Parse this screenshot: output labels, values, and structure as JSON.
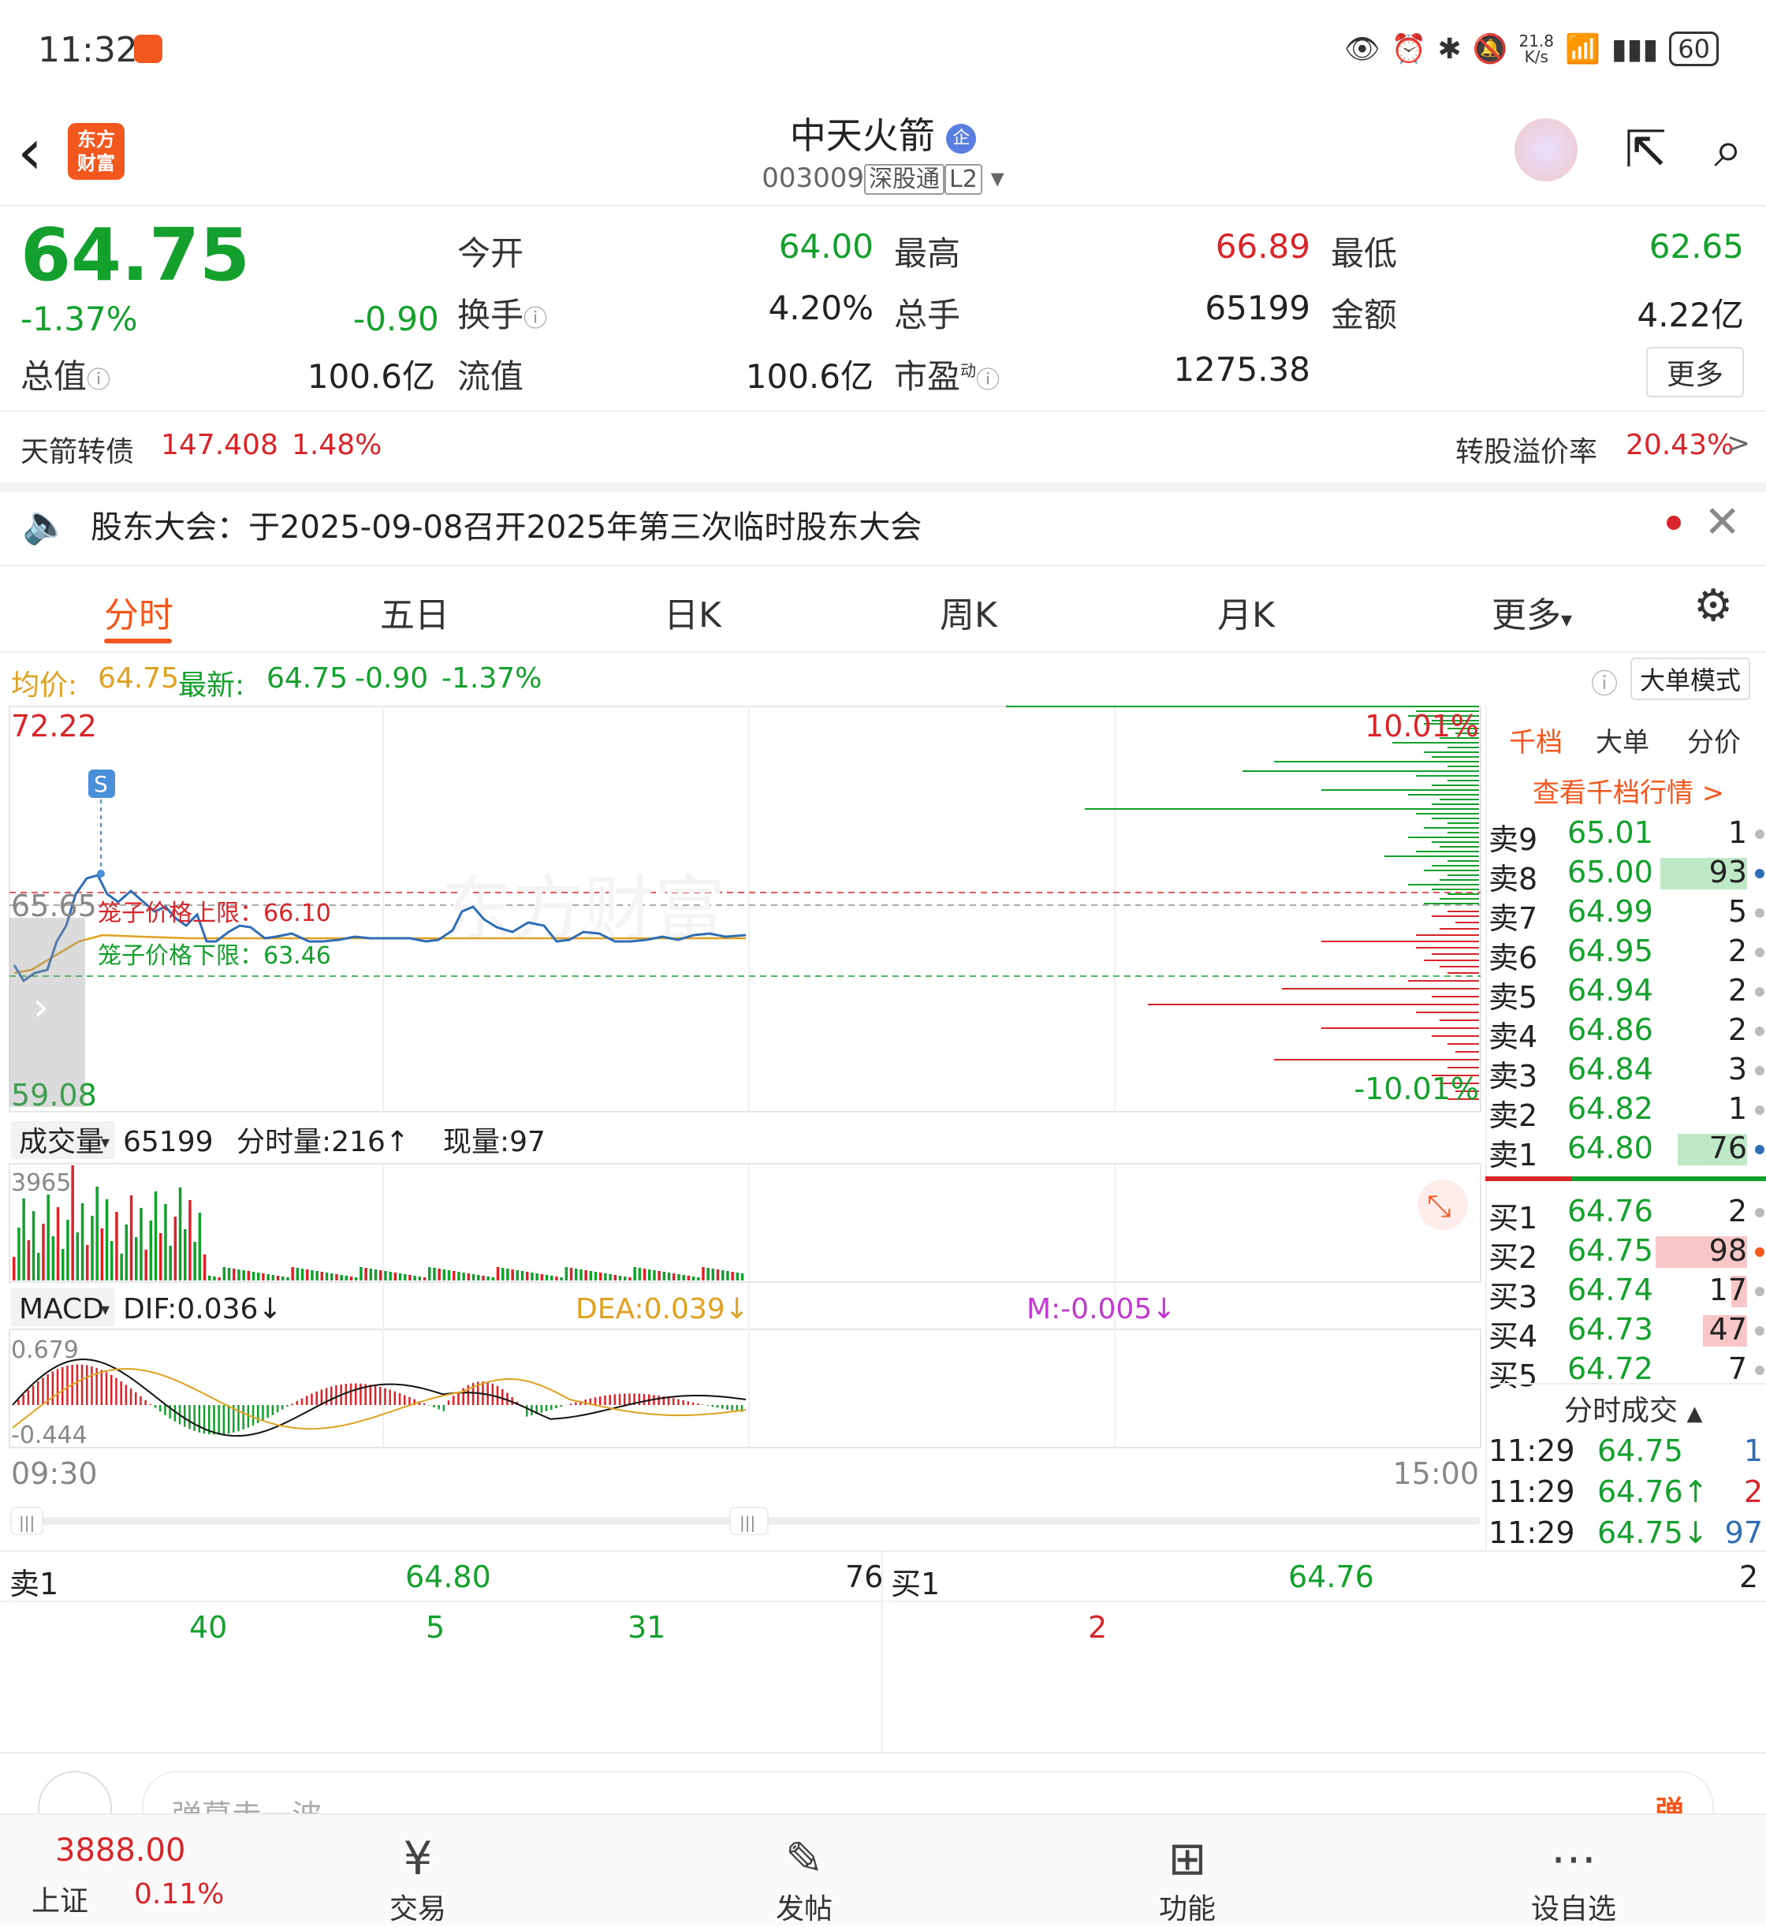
{
  "status": {
    "time": "11:32",
    "net_speed_top": "21.8",
    "net_speed_unit": "K/s",
    "battery": "60"
  },
  "header": {
    "title": "中天火箭",
    "badge": "企",
    "code": "003009",
    "tag1": "深股通",
    "tag2": "L2",
    "logo_line1": "东方",
    "logo_line2": "财富"
  },
  "quote": {
    "price": "64.75",
    "pct": "-1.37%",
    "chg": "-0.90",
    "open_label": "今开",
    "open": "64.00",
    "high_label": "最高",
    "high": "66.89",
    "low_label": "最低",
    "low": "62.65",
    "turnover_label": "换手",
    "turnover": "4.20%",
    "vol_label": "总手",
    "vol": "65199",
    "amount_label": "金额",
    "amount": "4.22亿",
    "mktcap_label": "总值",
    "mktcap": "100.6亿",
    "float_label": "流值",
    "float": "100.6亿",
    "pe_label": "市盈",
    "pe_sup": "动",
    "pe": "1275.38",
    "more": "更多"
  },
  "bond": {
    "name": "天箭转债",
    "price": "147.408",
    "pct": "1.48%",
    "premium_label": "转股溢价率",
    "premium": "20.43%"
  },
  "notice": {
    "text": "股东大会：于2025-09-08召开2025年第三次临时股东大会"
  },
  "tabs": [
    "分时",
    "五日",
    "日K",
    "周K",
    "月K",
    "更多"
  ],
  "infoline": {
    "avg_label": "均价:",
    "avg": "64.75",
    "last_label": "最新:",
    "last": "64.75",
    "chg": "-0.90",
    "pct": "-1.37%",
    "mode": "大单模式"
  },
  "chart": {
    "ymax": "72.22",
    "ymid": "65.65",
    "ymin": "59.08",
    "up_pct": "10.01%",
    "down_pct": "-10.01%",
    "cage_upper": "笼子价格上限：66.10",
    "cage_lower": "笼子价格下限：63.46",
    "s_marker": "S",
    "watermark": "东方财富",
    "vol_label": "成交量",
    "vol_total": "65199",
    "vol_min_label": "分时量:216",
    "vol_now_label": "现量:97",
    "vol_max": "3965",
    "macd_label": "MACD",
    "dif": "DIF:0.036",
    "dea": "DEA:0.039",
    "m": "M:-0.005",
    "macd_max": "0.679",
    "macd_min": "-0.444",
    "t_start": "09:30",
    "t_end": "15:00"
  },
  "book": {
    "tabs": [
      "千档",
      "大单",
      "分价"
    ],
    "link": "查看千档行情 >",
    "asks": [
      {
        "label": "卖9",
        "price": "65.01",
        "vol": "1"
      },
      {
        "label": "卖8",
        "price": "65.00",
        "vol": "93"
      },
      {
        "label": "卖7",
        "price": "64.99",
        "vol": "5"
      },
      {
        "label": "卖6",
        "price": "64.95",
        "vol": "2"
      },
      {
        "label": "卖5",
        "price": "64.94",
        "vol": "2"
      },
      {
        "label": "卖4",
        "price": "64.86",
        "vol": "2"
      },
      {
        "label": "卖3",
        "price": "64.84",
        "vol": "3"
      },
      {
        "label": "卖2",
        "price": "64.82",
        "vol": "1"
      },
      {
        "label": "卖1",
        "price": "64.80",
        "vol": "76"
      }
    ],
    "bids": [
      {
        "label": "买1",
        "price": "64.76",
        "vol": "2"
      },
      {
        "label": "买2",
        "price": "64.75",
        "vol": "98"
      },
      {
        "label": "买3",
        "price": "64.74",
        "vol": "17"
      },
      {
        "label": "买4",
        "price": "64.73",
        "vol": "47"
      },
      {
        "label": "买5",
        "price": "64.72",
        "vol": "7"
      }
    ],
    "ticks_title": "分时成交",
    "ticks": [
      {
        "time": "11:29",
        "price": "64.75",
        "vol": "1"
      },
      {
        "time": "11:29",
        "price": "64.76↑",
        "vol": "2"
      },
      {
        "time": "11:29",
        "price": "64.75↓",
        "vol": "97"
      }
    ]
  },
  "queue": {
    "sell_label": "卖1",
    "sell_price": "64.80",
    "sell_vol": "76",
    "buy_label": "买1",
    "buy_price": "64.76",
    "buy_vol": "2",
    "sell_orders": [
      "40",
      "5",
      "31"
    ],
    "buy_orders": [
      "2"
    ]
  },
  "comment": {
    "placeholder": "弹幕走一波",
    "btn": "弹"
  },
  "nav": {
    "index_value": "3888.00",
    "index_name": "上证",
    "index_pct": "0.11%",
    "items": [
      "交易",
      "发帖",
      "功能",
      "设自选"
    ]
  },
  "colors": {
    "up": "#d8252a",
    "down": "#13a02c",
    "accent": "#f2571e",
    "avg": "#e0a020",
    "price_line": "#2f6db5"
  }
}
